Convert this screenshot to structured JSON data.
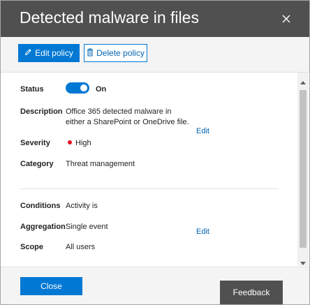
{
  "panel": {
    "title": "Detected malware in files"
  },
  "toolbar": {
    "edit_label": "Edit policy",
    "delete_label": "Delete policy"
  },
  "details": {
    "status": {
      "label": "Status",
      "state": "On"
    },
    "description": {
      "label": "Description",
      "text": "Office 365 detected malware in either a SharePoint or OneDrive file.",
      "edit_link": "Edit"
    },
    "severity": {
      "label": "Severity",
      "value": "High",
      "dot_color": "#e81123"
    },
    "category": {
      "label": "Category",
      "value": "Threat management"
    },
    "conditions": {
      "label": "Conditions",
      "value": "Activity is"
    },
    "aggregation": {
      "label": "Aggregation",
      "value": "Single event",
      "edit_link": "Edit"
    },
    "scope": {
      "label": "Scope",
      "value": "All users"
    }
  },
  "footer": {
    "close_label": "Close",
    "feedback_label": "Feedback"
  },
  "icons": {
    "close": "close-icon",
    "edit": "pencil-icon",
    "delete": "trash-icon",
    "scroll_up": "chevron-up-icon",
    "scroll_down": "chevron-down-icon"
  },
  "colors": {
    "header_bg": "#505050",
    "accent": "#0078d4",
    "link": "#0063b1",
    "severity_high": "#e81123"
  }
}
